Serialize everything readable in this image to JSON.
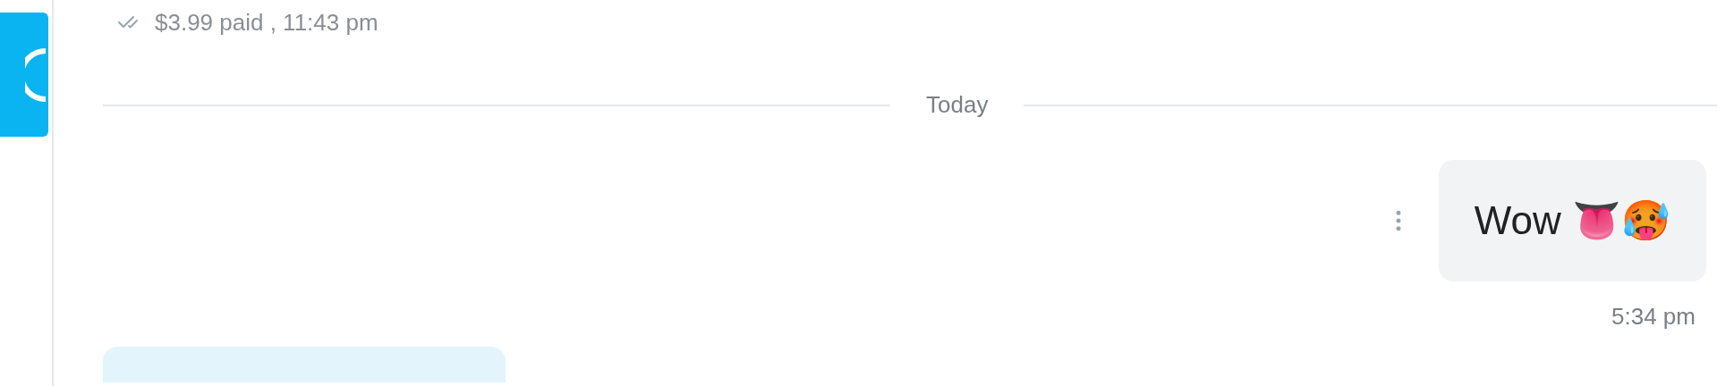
{
  "previous_message": {
    "status": "$3.99 paid , 11:43 pm"
  },
  "divider": {
    "label": "Today"
  },
  "messages": [
    {
      "text": "Wow 👅🥵",
      "time": "5:34 pm"
    }
  ]
}
